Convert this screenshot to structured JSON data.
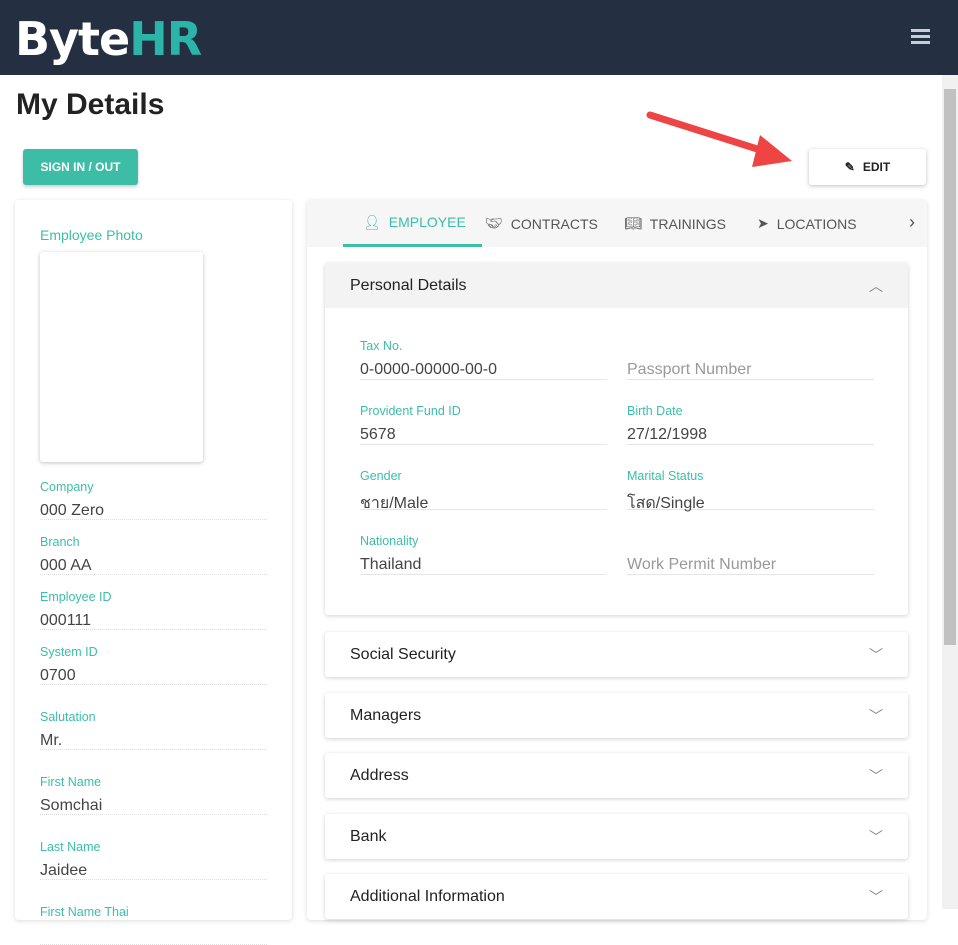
{
  "header": {
    "logo": "ByteHR",
    "menu_icon": "hamburger-icon"
  },
  "page_title": "My Details",
  "buttons": {
    "sign_in_out": "SIGN IN / OUT",
    "edit": "EDIT"
  },
  "colors": {
    "accent": "#3bbfa6",
    "header": "#243042",
    "arrow": "#ef4444"
  },
  "left_panel": {
    "photo_label": "Employee Photo",
    "fields": [
      {
        "label": "Company",
        "value": "000 Zero"
      },
      {
        "label": "Branch",
        "value": "000 AA"
      },
      {
        "label": "Employee ID",
        "value": "000111"
      },
      {
        "label": "System ID",
        "value": "0700"
      },
      {
        "label": "Salutation",
        "value": "Mr."
      },
      {
        "label": "First Name",
        "value": "Somchai"
      },
      {
        "label": "Last Name",
        "value": "Jaidee"
      },
      {
        "label": "First Name Thai",
        "value": ""
      }
    ]
  },
  "tabs": [
    {
      "label": "EMPLOYEE"
    },
    {
      "label": "CONTRACTS"
    },
    {
      "label": "TRAININGS"
    },
    {
      "label": "LOCATIONS"
    }
  ],
  "personal_details": {
    "title": "Personal Details",
    "fields": [
      {
        "label": "Tax No.",
        "value": "0-0000-00000-00-0"
      },
      {
        "placeholder": "Passport Number"
      },
      {
        "label": "Provident Fund ID",
        "value": "5678"
      },
      {
        "label": "Birth Date",
        "value": "27/12/1998"
      },
      {
        "label": "Gender",
        "value": "ชาย/Male"
      },
      {
        "label": "Marital Status",
        "value": "โสด/Single"
      },
      {
        "label": "Nationality",
        "value": "Thailand"
      },
      {
        "placeholder": "Work Permit Number"
      }
    ]
  },
  "sections": [
    "Social Security",
    "Managers",
    "Address",
    "Bank",
    "Additional Information"
  ]
}
